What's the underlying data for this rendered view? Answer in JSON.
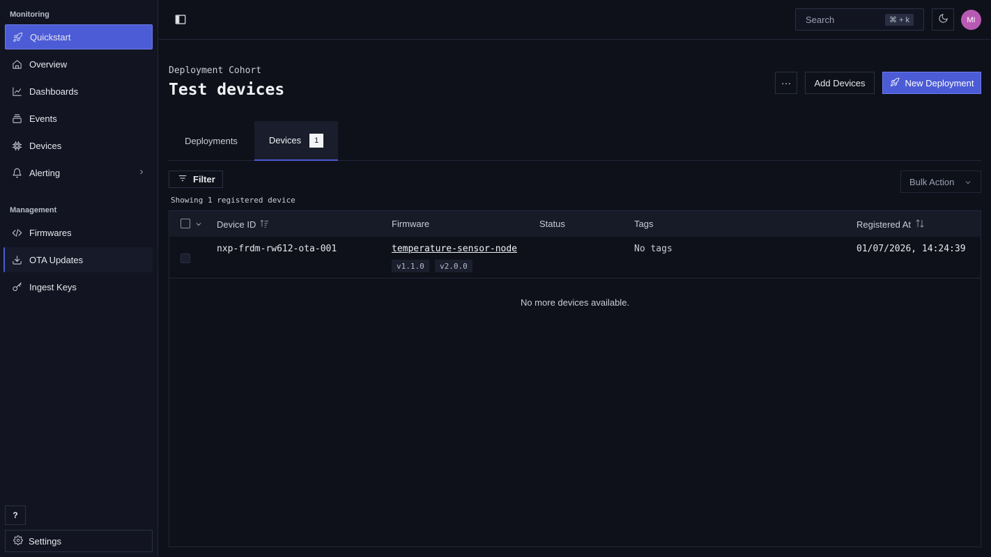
{
  "sidebar": {
    "monitoring_label": "Monitoring",
    "management_label": "Management",
    "items": [
      {
        "label": "Quickstart",
        "icon": "rocket-icon"
      },
      {
        "label": "Overview",
        "icon": "home-icon"
      },
      {
        "label": "Dashboards",
        "icon": "chart-icon"
      },
      {
        "label": "Events",
        "icon": "events-icon"
      },
      {
        "label": "Devices",
        "icon": "chip-icon"
      },
      {
        "label": "Alerting",
        "icon": "bell-icon"
      }
    ],
    "management_items": [
      {
        "label": "Firmwares",
        "icon": "code-icon"
      },
      {
        "label": "OTA Updates",
        "icon": "download-icon"
      },
      {
        "label": "Ingest Keys",
        "icon": "key-icon"
      }
    ],
    "help_label": "?",
    "settings_label": "Settings"
  },
  "topbar": {
    "search_placeholder": "Search",
    "search_shortcut": "⌘ + k",
    "avatar_initials": "MI"
  },
  "header": {
    "eyebrow": "Deployment Cohort",
    "title": "Test devices",
    "more_label": "···",
    "add_devices_label": "Add Devices",
    "new_deployment_label": "New Deployment"
  },
  "tabs": [
    {
      "label": "Deployments"
    },
    {
      "label": "Devices",
      "badge": "1"
    }
  ],
  "toolbar": {
    "filter_label": "Filter",
    "bulk_action_label": "Bulk Action",
    "showing_text": "Showing 1 registered device"
  },
  "table": {
    "columns": [
      "Device ID",
      "Firmware",
      "Status",
      "Tags",
      "Registered At"
    ],
    "rows": [
      {
        "device_id": "nxp-frdm-rw612-ota-001",
        "firmware": "temperature-sensor-node",
        "versions": [
          "v1.1.0",
          "v2.0.0"
        ],
        "status": "",
        "tags": "No tags",
        "registered_at": "01/07/2026, 14:24:39"
      }
    ],
    "empty_text": "No more devices available."
  },
  "colors": {
    "accent": "#4c5bd6",
    "background": "#0f111a",
    "sidebar": "#121521",
    "avatar": "#b85ab4"
  }
}
